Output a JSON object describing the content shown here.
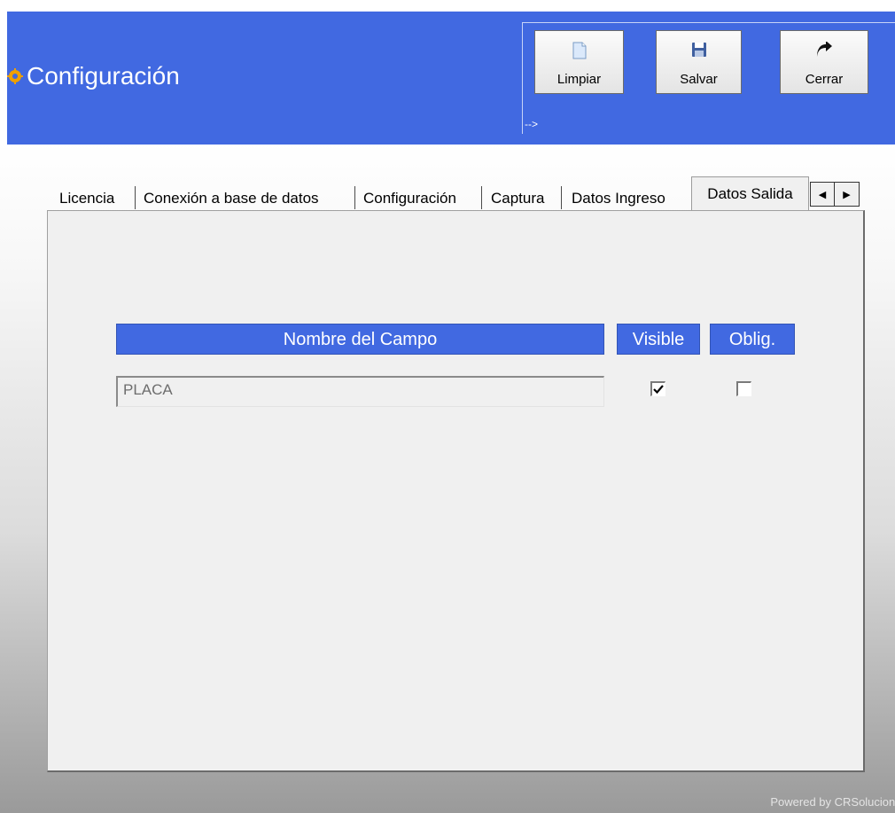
{
  "window": {
    "title": "Configuración"
  },
  "toolbar": {
    "limpiar_label": "Limpiar",
    "salvar_label": "Salvar",
    "cerrar_label": "Cerrar",
    "arrow_text": "-->"
  },
  "tabs": [
    {
      "label": "Licencia"
    },
    {
      "label": "Conexión a base de datos"
    },
    {
      "label": "Configuración"
    },
    {
      "label": "Captura"
    },
    {
      "label": "Datos Ingreso"
    },
    {
      "label": "Datos Salida",
      "active": true
    }
  ],
  "table": {
    "headers": {
      "name": "Nombre del Campo",
      "visible": "Visible",
      "required": "Oblig."
    },
    "rows": [
      {
        "field": "PLACA",
        "visible": true,
        "required": false
      }
    ]
  },
  "footer": {
    "text": "Powered by CRSoluciones"
  },
  "colors": {
    "header_blue": "#4169E1",
    "panel_bg": "#F0F0F0"
  },
  "icons": [
    "settings-gear-icon",
    "new-document-icon",
    "save-disk-icon",
    "exit-arrow-icon",
    "scroll-left-icon",
    "scroll-right-icon",
    "check-icon"
  ]
}
